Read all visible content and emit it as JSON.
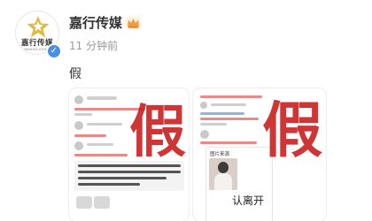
{
  "account": {
    "logo_text": "嘉行传媒",
    "logo_sub": "JIAYAHUA STUDIO",
    "name": "嘉行传媒",
    "time": "11 分钟前",
    "verified_icon": "verified-badge-icon",
    "crown_icon": "crown-icon"
  },
  "post": {
    "text": "假",
    "images": [
      {
        "stamp": "假",
        "caption": ""
      },
      {
        "stamp": "假",
        "card_title": "图片来源",
        "card_text": "认离开"
      }
    ]
  },
  "colors": {
    "stamp_red": "#c81919",
    "verified_blue": "#4a90e2",
    "name": "#333333",
    "time": "#999999"
  }
}
